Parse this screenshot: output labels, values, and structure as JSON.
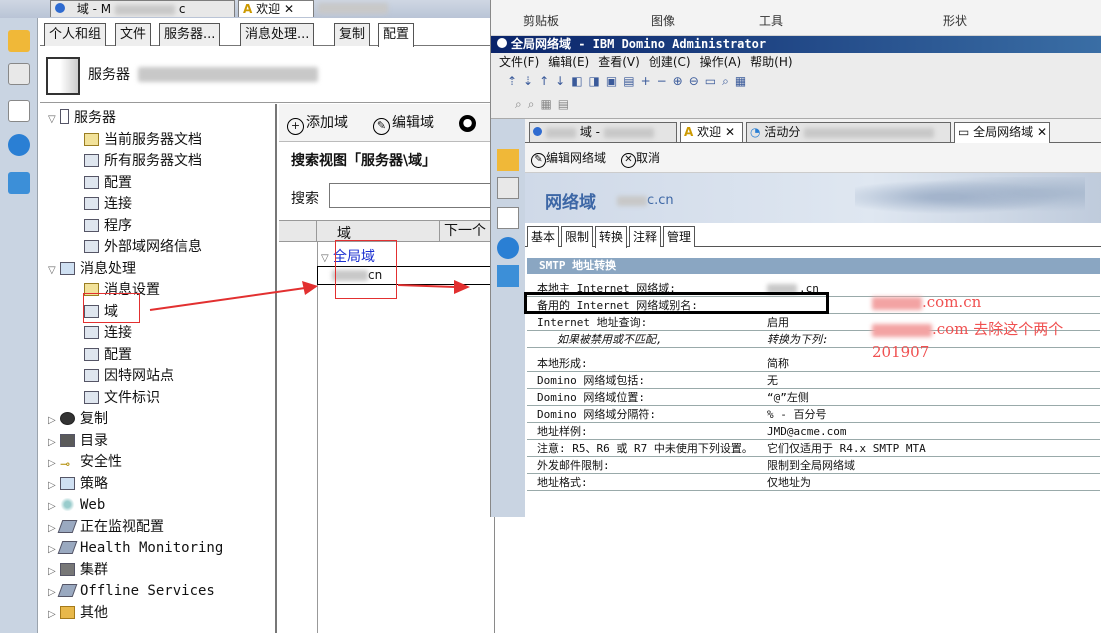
{
  "left": {
    "top_tabs": [
      "域 - M",
      "c",
      "欢迎"
    ],
    "tabs": [
      "个人和组",
      "文件",
      "服务器...",
      "消息处理...",
      "复制",
      "配置"
    ],
    "server_header": "服务器",
    "tree": [
      {
        "label": "服务器",
        "level": 0,
        "icon": "server-icon",
        "expand": "▽"
      },
      {
        "label": "当前服务器文档",
        "level": 1,
        "icon": "document-icon"
      },
      {
        "label": "所有服务器文档",
        "level": 1,
        "icon": "view-icon"
      },
      {
        "label": "配置",
        "level": 1,
        "icon": "view-icon"
      },
      {
        "label": "连接",
        "level": 1,
        "icon": "view-icon"
      },
      {
        "label": "程序",
        "level": 1,
        "icon": "view-icon"
      },
      {
        "label": "外部域网络信息",
        "level": 1,
        "icon": "view-icon"
      },
      {
        "label": "消息处理",
        "level": 0,
        "icon": "messaging-icon",
        "expand": "▽"
      },
      {
        "label": "消息设置",
        "level": 1,
        "icon": "document-icon"
      },
      {
        "label": "域",
        "level": 1,
        "icon": "view-icon",
        "selected": true
      },
      {
        "label": "连接",
        "level": 1,
        "icon": "view-icon"
      },
      {
        "label": "配置",
        "level": 1,
        "icon": "view-icon"
      },
      {
        "label": "因特网站点",
        "level": 1,
        "icon": "view-icon"
      },
      {
        "label": "文件标识",
        "level": 1,
        "icon": "view-icon"
      },
      {
        "label": "复制",
        "level": 0,
        "icon": "replication-icon",
        "expand": "▷"
      },
      {
        "label": "目录",
        "level": 0,
        "icon": "directory-icon",
        "expand": "▷"
      },
      {
        "label": "安全性",
        "level": 0,
        "icon": "key-icon",
        "expand": "▷"
      },
      {
        "label": "策略",
        "level": 0,
        "icon": "policy-icon",
        "expand": "▷"
      },
      {
        "label": "Web",
        "level": 0,
        "icon": "web-icon",
        "expand": "▷"
      },
      {
        "label": "正在监视配置",
        "level": 0,
        "icon": "monitor-icon",
        "expand": "▷"
      },
      {
        "label": "Health Monitoring",
        "level": 0,
        "icon": "health-icon",
        "expand": "▷"
      },
      {
        "label": "集群",
        "level": 0,
        "icon": "cluster-icon",
        "expand": "▷"
      },
      {
        "label": "Offline Services",
        "level": 0,
        "icon": "offline-icon",
        "expand": "▷"
      },
      {
        "label": "其他",
        "level": 0,
        "icon": "folder-icon",
        "expand": "▷"
      }
    ],
    "toolbar": {
      "add": "添加域",
      "edit": "编辑域"
    },
    "search_view_title": "搜索视图「服务器\\域」",
    "search_label": "搜索",
    "columns": [
      "域",
      "下一个"
    ],
    "rows": {
      "group": "全局域",
      "item": "cn"
    }
  },
  "right": {
    "ribbon": [
      "剪贴板",
      "图像",
      "工具",
      "形状"
    ],
    "title": "全局网络域 - IBM Domino Administrator",
    "menu": [
      "文件(F)",
      "编辑(E)",
      "查看(V)",
      "创建(C)",
      "操作(A)",
      "帮助(H)"
    ],
    "tabs": [
      "域 -",
      "欢迎",
      "活动分",
      "全局网络域"
    ],
    "actions": {
      "edit": "编辑网络域",
      "cancel": "取消"
    },
    "banner_title": "网络域",
    "banner_domain": "c.cn",
    "doc_tabs": [
      "基本",
      "限制",
      "转换",
      "注释",
      "管理"
    ],
    "section": "SMTP 地址转换",
    "fields": [
      {
        "label": "本地主 Internet 网络域:",
        "value": ".cn"
      },
      {
        "label": "备用的 Internet 网络域别名:",
        "value": ""
      },
      {
        "label": "Internet 地址查询:",
        "value": "启用"
      },
      {
        "label": "如果被禁用或不匹配,",
        "value": "转换为下列:"
      },
      {
        "label": "本地形成:",
        "value": "简称"
      },
      {
        "label": "Domino 网络域包括:",
        "value": "无"
      },
      {
        "label": "Domino 网络域位置:",
        "value": "“@”左侧"
      },
      {
        "label": "Domino 网络域分隔符:",
        "value": "% - 百分号"
      },
      {
        "label": "地址样例:",
        "value": "JMD@acme.com"
      },
      {
        "label": "注意: R5、R6 或 R7 中未使用下列设置。",
        "value": "它们仅适用于 R4.x SMTP MTA"
      },
      {
        "label": "外发邮件限制:",
        "value": "限制到全局网络域"
      },
      {
        "label": "地址格式:",
        "value": "仅地址为"
      }
    ],
    "annotations": [
      ".com.cn",
      ".com 去除这个两个",
      "201907"
    ]
  }
}
